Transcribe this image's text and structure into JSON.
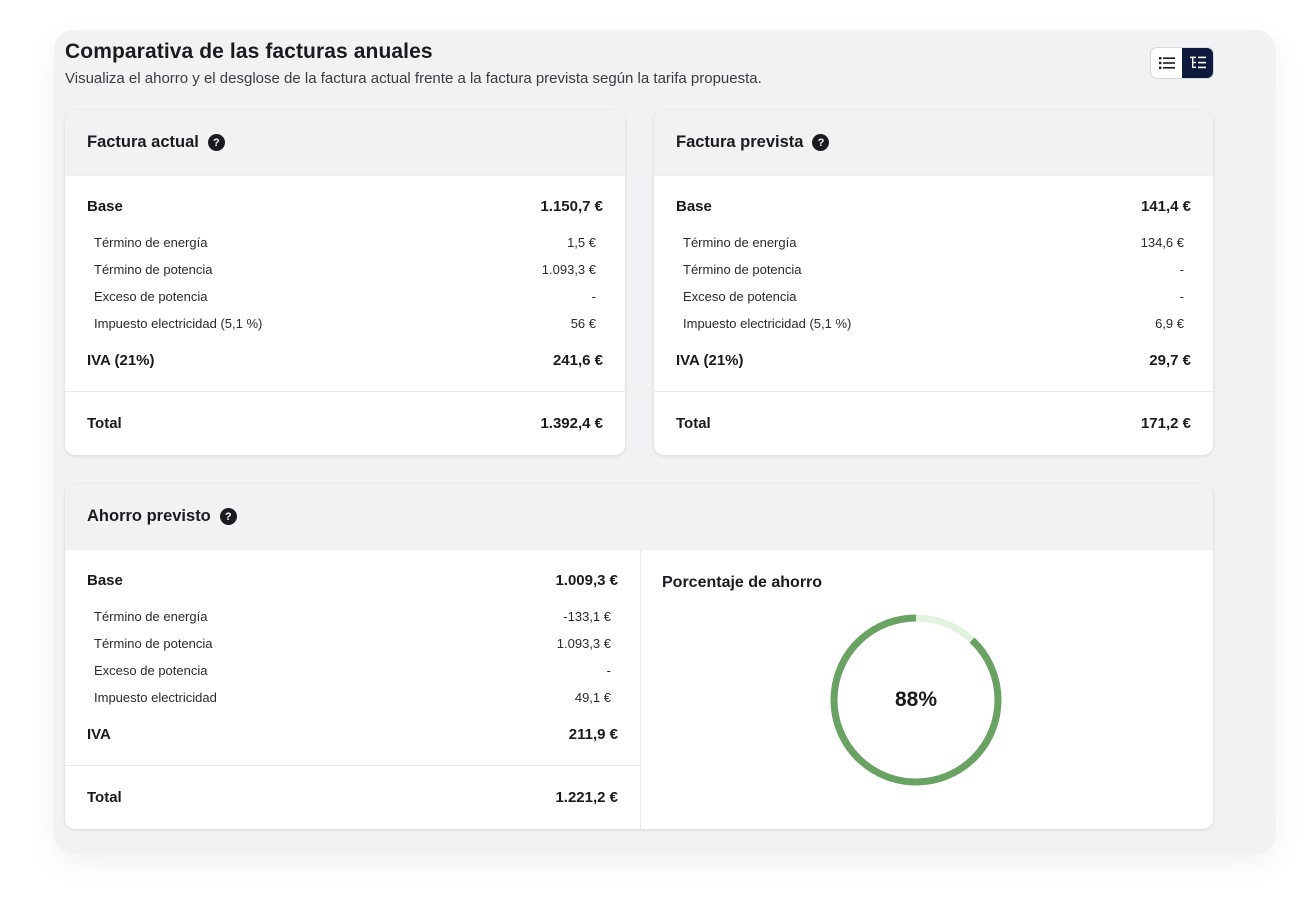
{
  "header": {
    "title": "Comparativa de las facturas anuales",
    "subtitle": "Visualiza el ahorro y el desglose de la factura actual frente a la factura prevista según la tarifa propuesta.",
    "view_toggle": {
      "left_icon": "list-icon",
      "right_icon": "tree-list-icon",
      "active": "right"
    }
  },
  "factura_actual": {
    "title": "Factura actual",
    "help": "?",
    "base": {
      "label": "Base",
      "value": "1.150,7 €"
    },
    "items": [
      {
        "label": "Término de energía",
        "value": "1,5 €"
      },
      {
        "label": "Término de potencia",
        "value": "1.093,3 €"
      },
      {
        "label": "Exceso de potencia",
        "value": "-"
      },
      {
        "label": "Impuesto electricidad (5,1 %)",
        "value": "56 €"
      }
    ],
    "iva": {
      "label": "IVA (21%)",
      "value": "241,6 €"
    },
    "total": {
      "label": "Total",
      "value": "1.392,4 €"
    }
  },
  "factura_prevista": {
    "title": "Factura prevista",
    "help": "?",
    "base": {
      "label": "Base",
      "value": "141,4 €"
    },
    "items": [
      {
        "label": "Término de energía",
        "value": "134,6 €"
      },
      {
        "label": "Término de potencia",
        "value": "-"
      },
      {
        "label": "Exceso de potencia",
        "value": "-"
      },
      {
        "label": "Impuesto electricidad (5,1 %)",
        "value": "6,9 €"
      }
    ],
    "iva": {
      "label": "IVA (21%)",
      "value": "29,7 €"
    },
    "total": {
      "label": "Total",
      "value": "171,2 €"
    }
  },
  "ahorro": {
    "title": "Ahorro previsto",
    "help": "?",
    "base": {
      "label": "Base",
      "value": "1.009,3 €"
    },
    "items": [
      {
        "label": "Término de energía",
        "value": "-133,1 €"
      },
      {
        "label": "Término de potencia",
        "value": "1.093,3 €"
      },
      {
        "label": "Exceso de potencia",
        "value": "-"
      },
      {
        "label": "Impuesto electricidad",
        "value": "49,1 €"
      }
    ],
    "iva": {
      "label": "IVA",
      "value": "211,9 €"
    },
    "total": {
      "label": "Total",
      "value": "1.221,2 €"
    },
    "percentage": {
      "title": "Porcentaje de ahorro",
      "label": "88%",
      "value": 0.88,
      "color": "#6aa263",
      "track_color": "#e4f3e0"
    }
  }
}
